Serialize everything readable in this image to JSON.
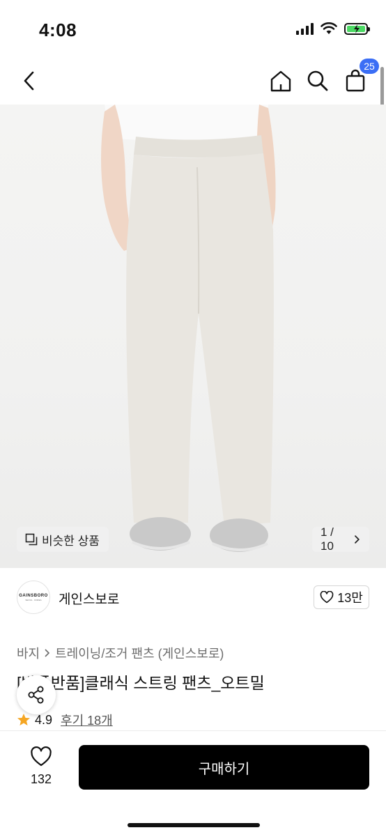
{
  "status": {
    "time": "4:08"
  },
  "header": {
    "cart_count": "25"
  },
  "hero": {
    "similar_label": "비슷한 상품",
    "page_indicator": "1 / 10",
    "pants_color": "#e9e6e0",
    "sneaker_color": "#c9c9c9"
  },
  "shop": {
    "logo_line1": "GAINSBORO",
    "logo_line2": "SEOUL · KOREA",
    "name": "게인스보로",
    "likes": "13만"
  },
  "breadcrumb": {
    "level1": "바지",
    "level2": "트레이닝/조거 팬츠 (게인스보로)"
  },
  "product": {
    "title": "[반품반품]클래식 스트링 팬츠_오트밀",
    "rating": "4.9",
    "reviews": "후기 18개"
  },
  "bottom": {
    "wish_count": "132",
    "buy_label": "구매하기"
  },
  "colors": {
    "badge": "#3b6ef5",
    "star": "#f5a623",
    "buy_button": "#000000"
  }
}
